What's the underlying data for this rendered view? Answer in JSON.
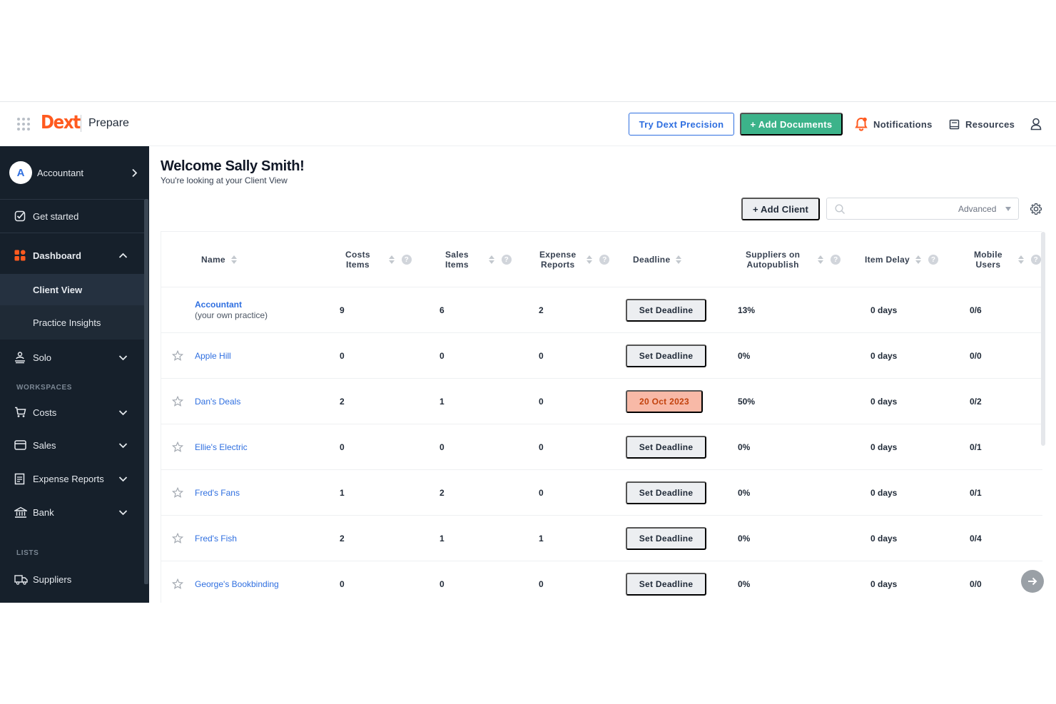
{
  "app": {
    "brand": "Dext",
    "product": "Prepare"
  },
  "header": {
    "try_precision_label": "Try Dext Precision",
    "add_documents_label": "+ Add Documents",
    "notifications_label": "Notifications",
    "resources_label": "Resources"
  },
  "sidebar": {
    "account": {
      "avatar_letter": "A",
      "label": "Accountant"
    },
    "get_started": "Get started",
    "dashboard": "Dashboard",
    "client_view": "Client View",
    "practice_insights": "Practice Insights",
    "solo": "Solo",
    "workspaces_heading": "WORKSPACES",
    "costs": "Costs",
    "sales": "Sales",
    "expense_reports": "Expense Reports",
    "bank": "Bank",
    "lists_heading": "LISTS",
    "suppliers": "Suppliers"
  },
  "main": {
    "welcome": "Welcome Sally Smith!",
    "subtitle": "You're looking at your Client View",
    "add_client_label": "+ Add Client",
    "search_placeholder": "",
    "advanced_label": "Advanced"
  },
  "table": {
    "columns": {
      "name": "Name",
      "costs_1": "Costs",
      "costs_2": "Items",
      "sales_1": "Sales",
      "sales_2": "Items",
      "expense_1": "Expense",
      "expense_2": "Reports",
      "deadline": "Deadline",
      "suppliers_1": "Suppliers on",
      "suppliers_2": "Autopublish",
      "item_delay": "Item Delay",
      "mobile_1": "Mobile",
      "mobile_2": "Users",
      "help_glyph": "?"
    },
    "own_practice": {
      "name": "Accountant",
      "sub": "(your own practice)",
      "costs": "9",
      "sales": "6",
      "expense": "2",
      "deadline": "Set Deadline",
      "suppliers": "13%",
      "delay": "0 days",
      "mobile": "0/6"
    },
    "rows": [
      {
        "name": "Apple Hill",
        "costs": "0",
        "sales": "0",
        "expense": "0",
        "deadline": "Set Deadline",
        "suppliers": "0%",
        "delay": "0 days",
        "mobile": "0/0"
      },
      {
        "name": "Dan's Deals",
        "costs": "2",
        "sales": "1",
        "expense": "0",
        "deadline": "20 Oct 2023",
        "suppliers": "50%",
        "delay": "0 days",
        "mobile": "0/2"
      },
      {
        "name": "Ellie's Electric",
        "costs": "0",
        "sales": "0",
        "expense": "0",
        "deadline": "Set Deadline",
        "suppliers": "0%",
        "delay": "0 days",
        "mobile": "0/1"
      },
      {
        "name": "Fred's Fans",
        "costs": "1",
        "sales": "2",
        "expense": "0",
        "deadline": "Set Deadline",
        "suppliers": "0%",
        "delay": "0 days",
        "mobile": "0/1"
      },
      {
        "name": "Fred's Fish",
        "costs": "2",
        "sales": "1",
        "expense": "1",
        "deadline": "Set Deadline",
        "suppliers": "0%",
        "delay": "0 days",
        "mobile": "0/4"
      },
      {
        "name": "George's Bookbinding",
        "costs": "0",
        "sales": "0",
        "expense": "0",
        "deadline": "Set Deadline",
        "suppliers": "0%",
        "delay": "0 days",
        "mobile": "0/0"
      }
    ]
  },
  "colors": {
    "brand_orange": "#ff5a1f",
    "primary_blue": "#2f6fe0",
    "add_green": "#3cb38a",
    "sidebar_bg": "#16202b",
    "overdue_bg": "#f8b9a7"
  }
}
